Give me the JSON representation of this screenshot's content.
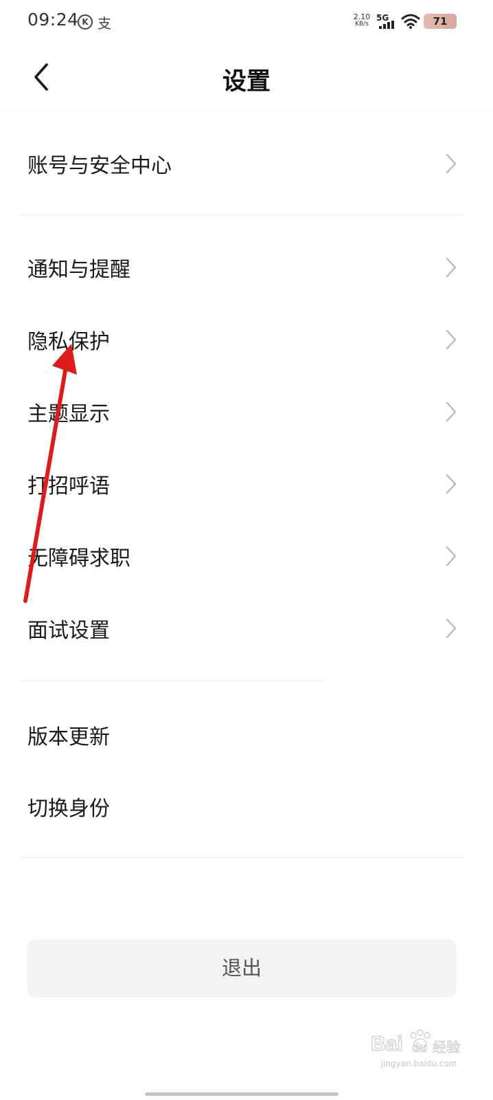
{
  "status_bar": {
    "time": "09:24",
    "k_icon_glyph": "K",
    "pay_icon_glyph": "支",
    "speed_value": "2.10",
    "speed_unit": "KB/s",
    "network": "5G",
    "battery": "71"
  },
  "header": {
    "title": "设置"
  },
  "menu": {
    "group1": [
      {
        "label": "账号与安全中心"
      }
    ],
    "group2": [
      {
        "label": "通知与提醒"
      },
      {
        "label": "隐私保护"
      },
      {
        "label": "主题显示"
      },
      {
        "label": "打招呼语"
      },
      {
        "label": "无障碍求职"
      },
      {
        "label": "面试设置"
      }
    ],
    "group3": [
      {
        "label": "版本更新"
      },
      {
        "label": "切换身份"
      }
    ]
  },
  "logout": {
    "label": "退出"
  },
  "watermark": {
    "text": "jingyan.baidu.com"
  },
  "colors": {
    "background": "#ffffff",
    "text": "#1a1a1a",
    "chevron": "#b8b8b8",
    "divider": "#efefef",
    "logout_bg": "#f3f3f3",
    "annotation_arrow": "#dd1c1c"
  }
}
